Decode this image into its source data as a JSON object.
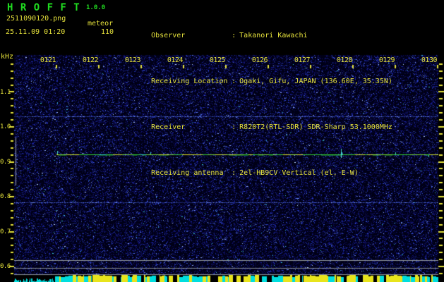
{
  "header": {
    "title": "H R O F F T",
    "version": "1.0.0",
    "filename": "2511090120.png",
    "mode": "meteor",
    "datetime": "25.11.09 01:20",
    "count": "110",
    "colon": ":",
    "info": [
      {
        "label": "Observer",
        "value": "Takanori Kawachi"
      },
      {
        "label": "Receiving Location",
        "value": "Ogaki, Gifu, JAPAN (136.60E, 35.35N)"
      },
      {
        "label": "Receiver",
        "value": "R820T2(RTL-SDR) SDR-Sharp 53.1000MHz"
      },
      {
        "label": "Receiving antenna",
        "value": "2el-HB9CV Vertical (el. E-W)"
      }
    ]
  },
  "spectrogram": {
    "y_axis": {
      "unit": "kHz",
      "tick_labels": [
        "1.1",
        "1.0",
        "0.9",
        "0.8",
        "0.7",
        "0.6"
      ]
    },
    "x_axis": {
      "tick_labels": [
        "0121",
        "0122",
        "0123",
        "0124",
        "0125",
        "0126",
        "0127",
        "0128",
        "0129",
        "0130"
      ]
    },
    "carrier": {
      "frequency_khz": 0.93,
      "start_label": "0121",
      "end_label": "0130"
    }
  },
  "colors": {
    "background": "#000000",
    "text_yellow": "#e6e23c",
    "title_green": "#20dd20",
    "noise_blue": "#1c2aa2",
    "carrier_green": "#36d438",
    "bar_yellow": "#e8e41c",
    "bar_cyan": "#00dede",
    "grid_grey": "#8a9098"
  }
}
